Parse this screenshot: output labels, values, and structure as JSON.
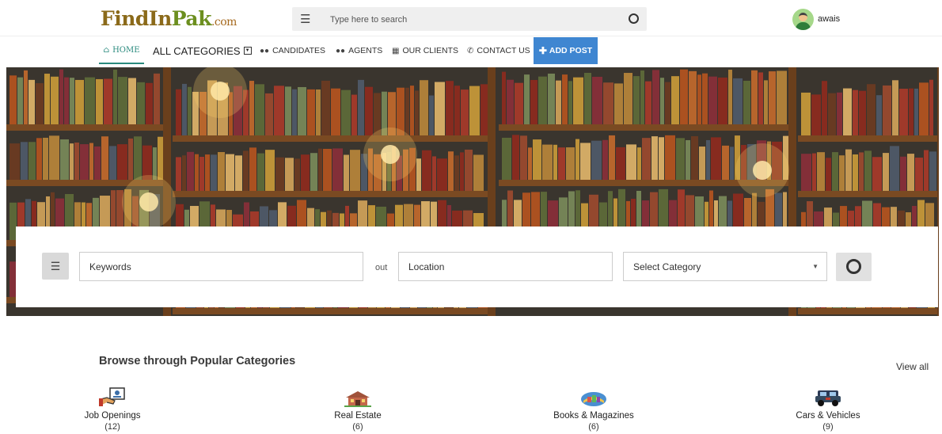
{
  "header": {
    "logo": {
      "part1": "Find",
      "part2": "In",
      "part3": "Pak",
      "part4": ".com"
    },
    "search_placeholder": "Type here to search",
    "user_name": "awais"
  },
  "nav": {
    "home": "HOME",
    "all_categories": "ALL CATEGORIES",
    "candidates": "CANDIDATES",
    "agents": "AGENTS",
    "our_clients": "OUR CLIENTS",
    "contact_us": "CONTACT US",
    "add_post": "ADD POST"
  },
  "search": {
    "keywords_placeholder": "Keywords",
    "connector": "out",
    "location_placeholder": "Location",
    "category_selected": "Select Category"
  },
  "categories": {
    "title": "Browse through Popular Categories",
    "view_all": "View all",
    "items": [
      {
        "name": "Job Openings",
        "count": "(12)",
        "icon": "job-icon"
      },
      {
        "name": "Real Estate",
        "count": "(6)",
        "icon": "house-icon"
      },
      {
        "name": "Books & Magazines",
        "count": "(6)",
        "icon": "books-icon"
      },
      {
        "name": "Cars & Vehicles",
        "count": "(9)",
        "icon": "car-icon"
      }
    ]
  },
  "colors": {
    "accent_teal": "#2a8a7e",
    "add_post_blue": "#3f86d1"
  }
}
